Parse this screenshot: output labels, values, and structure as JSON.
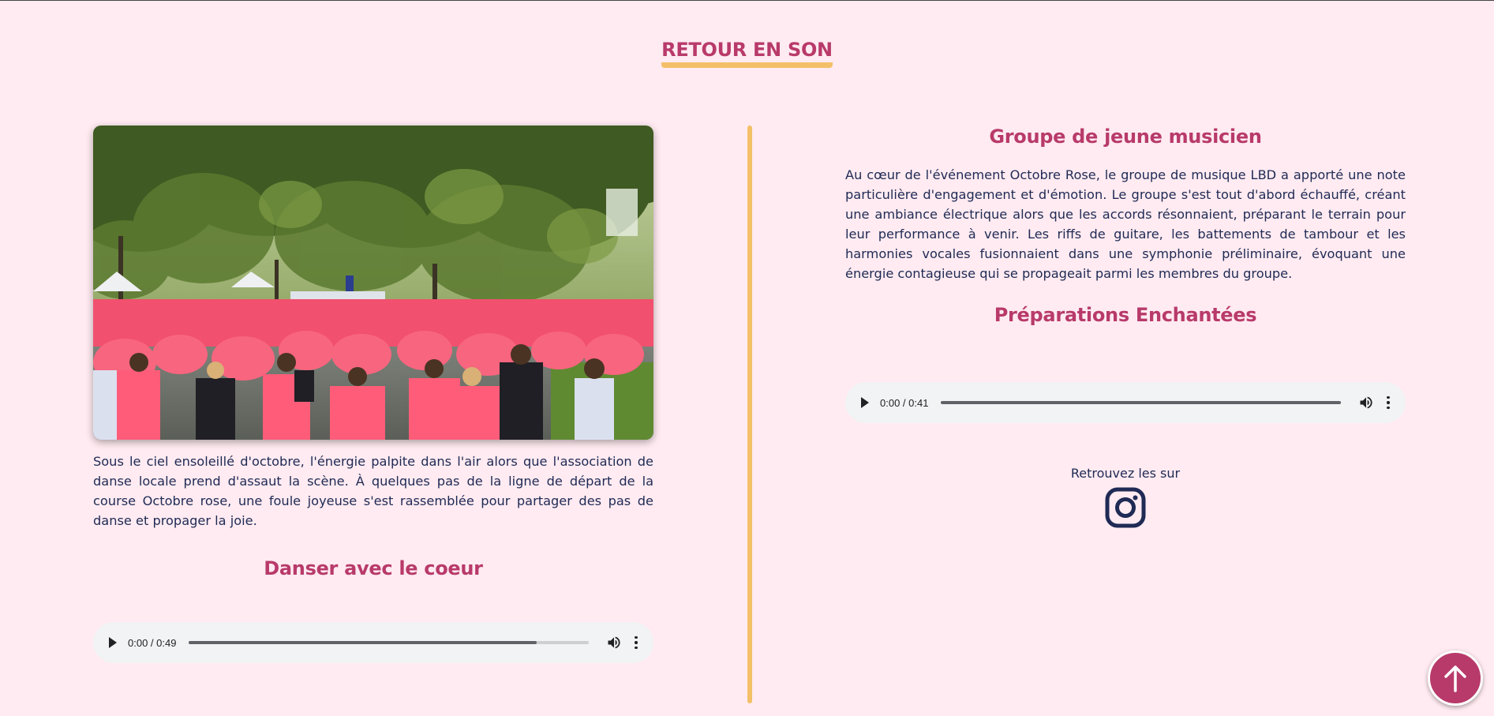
{
  "page": {
    "section_title": "RETOUR EN SON"
  },
  "left": {
    "photo_alt": "",
    "paragraph": "Sous le ciel ensoleillé d'octobre, l'énergie palpite dans l'air alors que l'association de danse locale prend d'assaut la scène. À quelques pas de la ligne de départ de la course Octobre rose, une foule joyeuse s'est rassemblée pour partager des pas de danse et propager la joie.",
    "subhead": "Danser avec le coeur",
    "audio": {
      "time": "0:00 / 0:49",
      "buffered_fraction": 0.87
    }
  },
  "right": {
    "heading": "Groupe de jeune musicien",
    "paragraph": "Au cœur de l'événement Octobre Rose, le groupe de musique LBD a apporté une note particulière d'engagement et d'émotion. Le groupe s'est tout d'abord échauffé, créant une ambiance électrique alors que les accords résonnaient, préparant le terrain pour leur performance à venir. Les riffs de guitare, les battements de tambour et les harmonies vocales fusionnaient dans une symphonie préliminaire, évoquant une énergie contagieuse qui se propageait parmi les membres du groupe.",
    "subhead": "Préparations Enchantées",
    "audio": {
      "time": "0:00 / 0:41",
      "buffered_fraction": 1.0
    },
    "follow_text": "Retrouvez les sur"
  },
  "icons": {
    "instagram": "instagram-icon",
    "back_to_top": "arrow-up-icon",
    "play": "play-icon",
    "volume": "volume-icon",
    "more": "more-vert-icon"
  },
  "colors": {
    "background": "#ffebf1",
    "accent_pink": "#b83a6a",
    "accent_yellow": "#f3c067",
    "text_navy": "#1f2a55"
  }
}
